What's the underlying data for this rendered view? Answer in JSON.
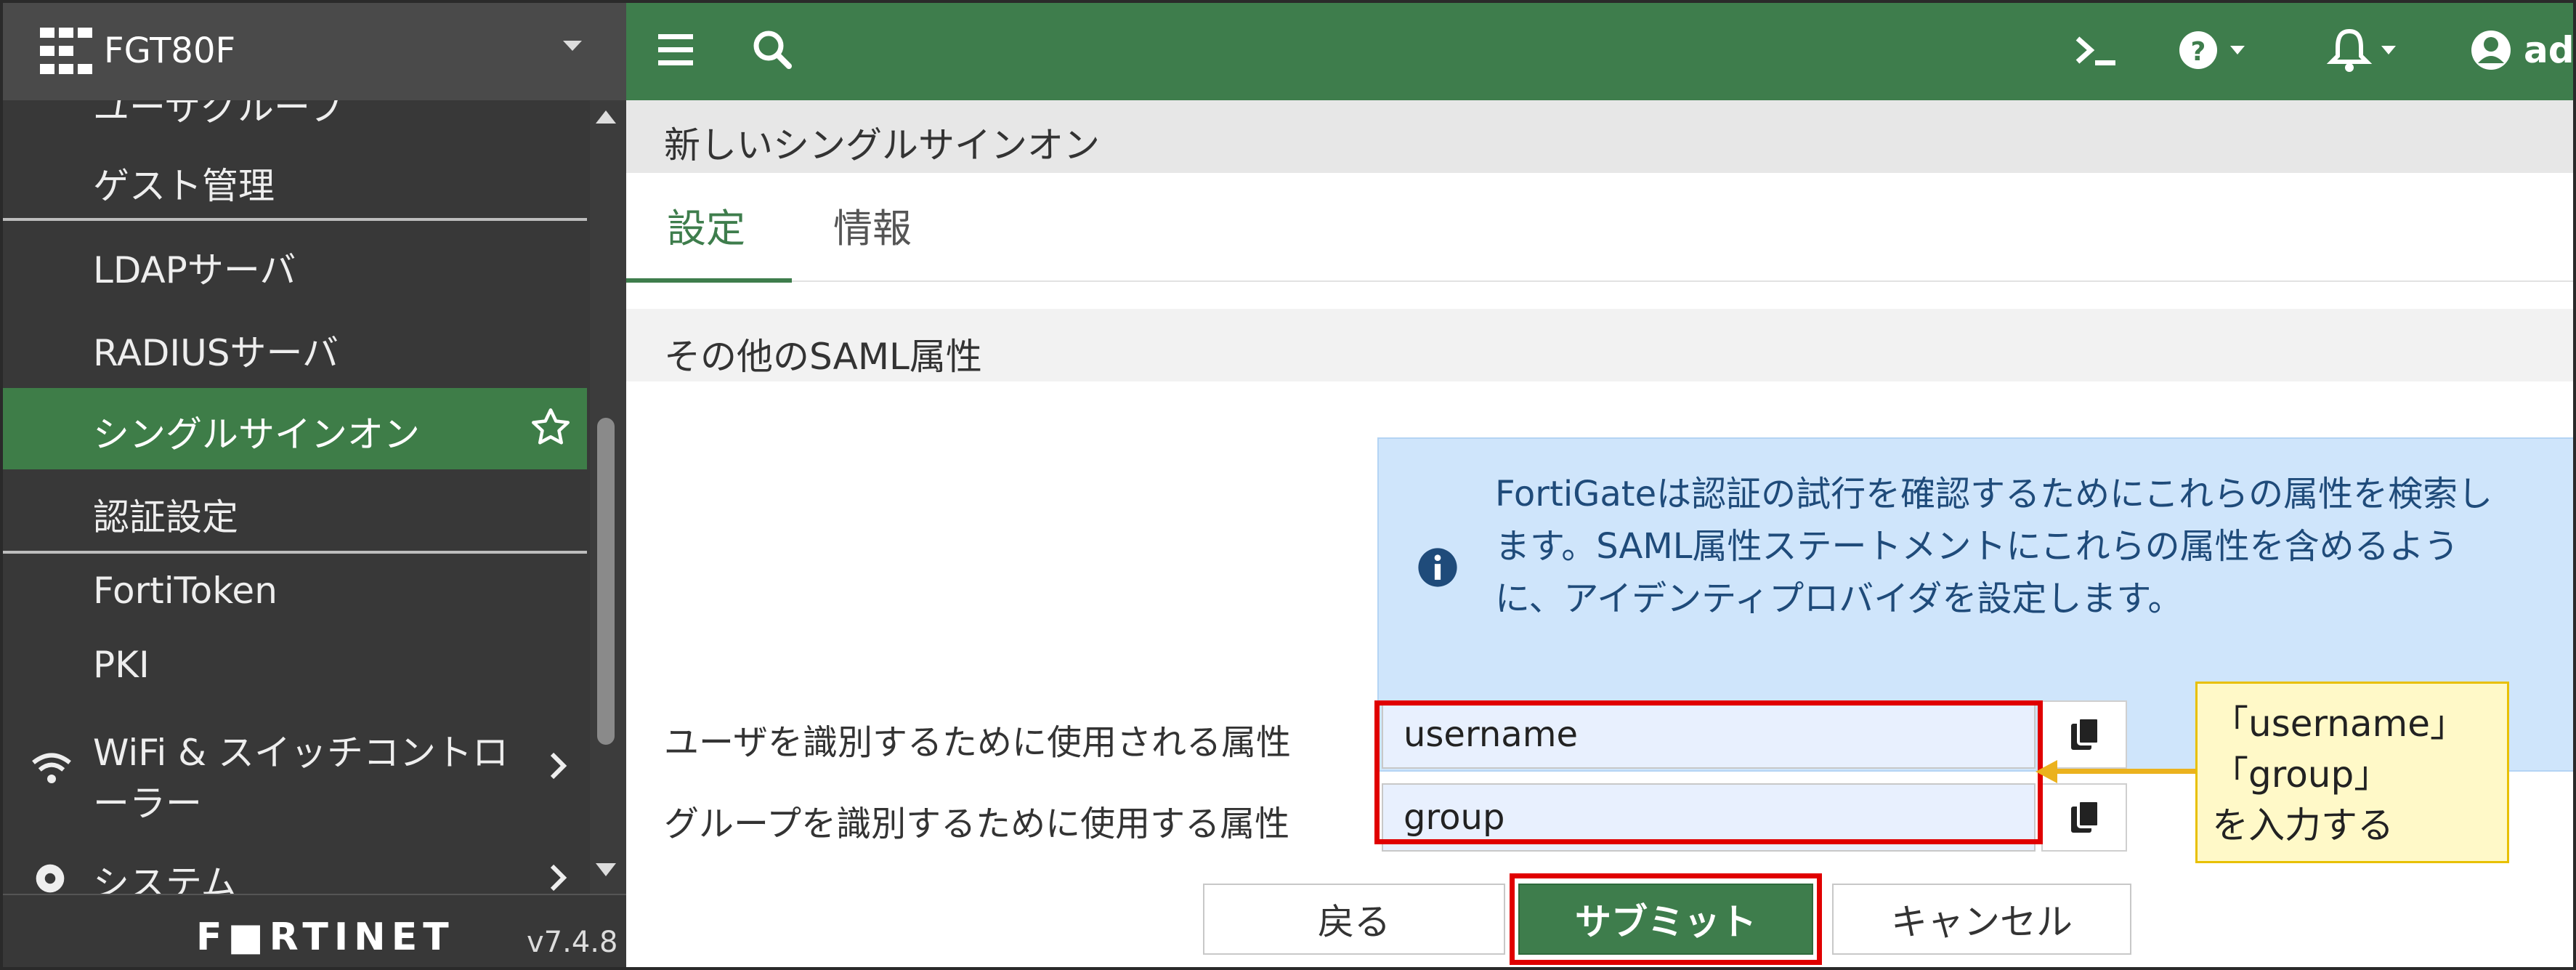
{
  "sidebar": {
    "device_name": "FGT80F",
    "partial_top_label": "ユーザグループ",
    "items": [
      {
        "label": "ゲスト管理"
      },
      {
        "label": "LDAPサーバ"
      },
      {
        "label": "RADIUSサーバ"
      },
      {
        "label": "シングルサインオン",
        "active": true
      },
      {
        "label": "認証設定"
      },
      {
        "label": "FortiToken"
      },
      {
        "label": "PKI"
      }
    ],
    "wifi": {
      "line1": "WiFi & スイッチコントロ",
      "line2": "ーラー"
    },
    "system": "システム",
    "brand": "F■RTINET",
    "version": "v7.4.8"
  },
  "topbar": {
    "user_partial": "adr",
    "icons": [
      "menu-icon",
      "search-icon",
      "cli-icon",
      "help-icon",
      "bell-icon",
      "user-icon"
    ]
  },
  "page": {
    "title": "新しいシングルサインオン",
    "tabs": [
      {
        "label": "設定",
        "active": true
      },
      {
        "label": "情報"
      }
    ],
    "section_title": "その他のSAML属性",
    "info": {
      "line1": "FortiGateは認証の試行を確認するためにこれらの属性を検索し",
      "line2": "ます。SAML属性ステートメントにこれらの属性を含めるよう",
      "line3": "に、アイデンティプロバイダを設定します。"
    },
    "fields": {
      "user_attr_label": "ユーザを識別するために使用される属性",
      "user_attr_value": "username",
      "group_attr_label": "グループを識別するために使用する属性",
      "group_attr_value": "group"
    },
    "callout": {
      "line1": "「username」",
      "line2": "「group」",
      "line3": "を入力する"
    },
    "buttons": {
      "back": "戻る",
      "submit": "サブミット",
      "cancel": "キャンセル"
    }
  },
  "colors": {
    "brand_green": "#3e7d4c",
    "highlight_red": "#e00000",
    "callout_yellow": "#fff9c8"
  }
}
